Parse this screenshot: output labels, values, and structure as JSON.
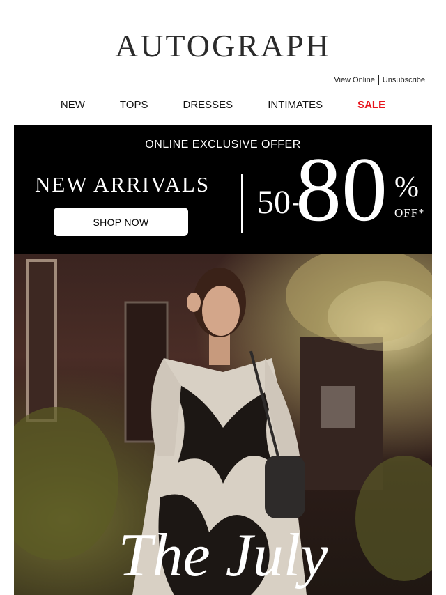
{
  "brand": {
    "logo": "AUTOGRAPH"
  },
  "utility": {
    "view_online": "View Online",
    "unsubscribe": "Unsubscribe"
  },
  "nav": {
    "items": [
      "NEW",
      "TOPS",
      "DRESSES",
      "INTIMATES",
      "SALE"
    ]
  },
  "banner": {
    "top_text": "ONLINE EXCLUSIVE OFFER",
    "headline": "NEW ARRIVALS",
    "button": "SHOP NOW",
    "discount_low": "50",
    "discount_high": "80",
    "percent": "%",
    "off": "OFF*"
  },
  "hero": {
    "title": "The July"
  },
  "colors": {
    "sale": "#e8141c",
    "banner_bg": "#000000"
  }
}
